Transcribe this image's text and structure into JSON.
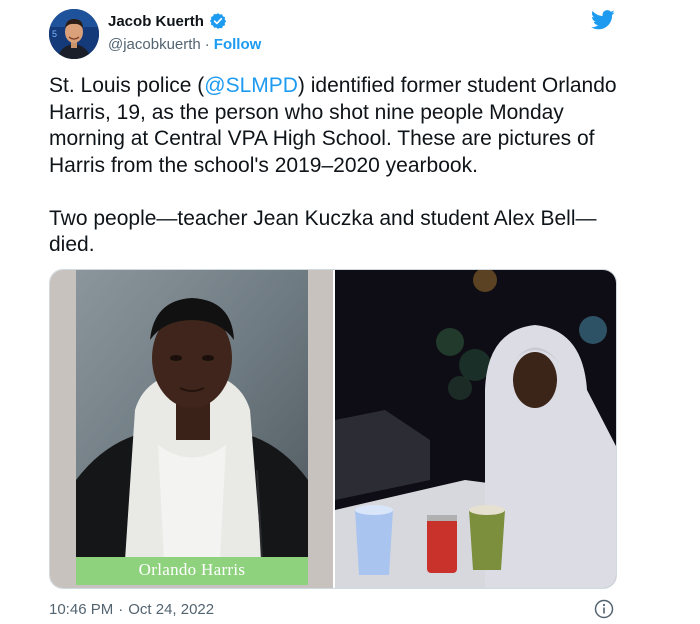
{
  "author": {
    "display_name": "Jacob Kuerth",
    "handle": "@jacobkuerth",
    "separator": "·",
    "follow_label": "Follow",
    "verified": true
  },
  "tweet": {
    "paragraph1_before": "St. Louis police (",
    "mention": "@SLMPD",
    "paragraph1_after": ") identified former student Orlando Harris, 19, as the person who shot nine people Monday morning at Central VPA High School. These are pictures of Harris from the school's 2019–2020 yearbook.",
    "paragraph2": "Two people—teacher Jean Kuczka and student Alex Bell—died."
  },
  "media": {
    "left_caption": "Orlando Harris"
  },
  "footer": {
    "time": "10:46 PM",
    "separator": "·",
    "date": "Oct 24, 2022"
  },
  "colors": {
    "accent": "#1d9bf0",
    "text": "#0f1419",
    "secondary_text": "#536471",
    "caption_band": "#8fd27e"
  },
  "icons": {
    "verified": "verified-badge-icon",
    "brand": "twitter-bird-icon",
    "info": "info-icon"
  }
}
